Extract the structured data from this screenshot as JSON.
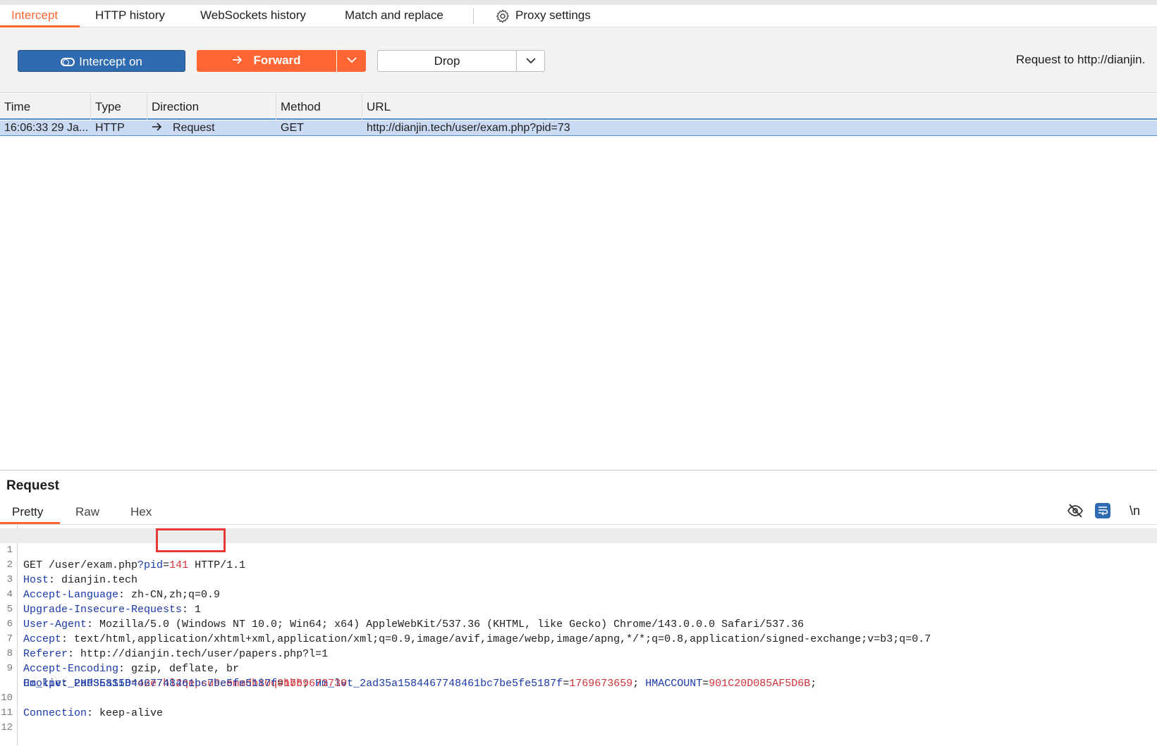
{
  "tabs": [
    {
      "label": "Intercept",
      "active": true
    },
    {
      "label": "HTTP history"
    },
    {
      "label": "WebSockets history"
    },
    {
      "label": "Match and replace"
    },
    {
      "label": "Proxy settings",
      "icon": "gear-icon"
    }
  ],
  "toolbar": {
    "intercept_label": "Intercept on",
    "forward_label": "Forward",
    "drop_label": "Drop",
    "request_to": "Request to http://dianjin."
  },
  "table": {
    "headers": [
      "Time",
      "Type",
      "Direction",
      "Method",
      "URL"
    ],
    "rows": [
      {
        "time": "16:06:33 29 Ja...",
        "type": "HTTP",
        "direction": "Request",
        "method": "GET",
        "url": "http://dianjin.tech/user/exam.php?pid=73"
      }
    ]
  },
  "request_panel": {
    "title": "Request",
    "subtabs": [
      "Pretty",
      "Raw",
      "Hex"
    ],
    "active_subtab": "Pretty",
    "newline_toggle": "\\n",
    "lines": {
      "l1": {
        "pre": "GET /user/exam.php",
        "param_key": "?pid",
        "eq": "=",
        "param_val": "141",
        "post": " HTTP/1.1"
      },
      "l2": {
        "name": "Host",
        "value": ": dianjin.tech"
      },
      "l3": {
        "name": "Accept-Language",
        "value": ": zh-CN,zh;q=0.9"
      },
      "l4": {
        "name": "Upgrade-Insecure-Requests",
        "value": ": 1"
      },
      "l5": {
        "name": "User-Agent",
        "value": ": Mozilla/5.0 (Windows NT 10.0; Win64; x64) AppleWebKit/537.36 (KHTML, like Gecko) Chrome/143.0.0.0 Safari/537.36"
      },
      "l6": {
        "name": "Accept",
        "value": ": text/html,application/xhtml+xml,application/xml;q=0.9,image/avif,image/webp,image/apng,*/*;q=0.8,application/signed-exchange;v=b3;q=0.7"
      },
      "l7": {
        "name": "Referer",
        "value": ": http://dianjin.tech/user/papers.php?l=1"
      },
      "l8": {
        "name": "Accept-Encoding",
        "value": ": gzip, deflate, br"
      },
      "l9": {
        "name": "Cookie",
        "sep": ": ",
        "c1k": "PHPSESSID",
        "c1v": "o2e7hl2qepsu9eemmdbi0q9hbb",
        "c2k": "Hm_lvt_2ad35a15844677484​61bc7be5fe5187f",
        "c2v": "1769673659",
        "c3k": "HMACCOUNT",
        "c3v": "901C20D085AF5D6B"
      },
      "l9b": {
        "c4k": "Hm_lpvt_2ad35a1584467748461bc7be5fe5187f",
        "c4v": "1769673730"
      },
      "l10": {
        "name": "Connection",
        "value": ": keep-alive"
      }
    },
    "line_numbers": [
      "1",
      "2",
      "3",
      "4",
      "5",
      "6",
      "7",
      "8",
      "9",
      "10",
      "11",
      "12"
    ]
  },
  "colors": {
    "accent": "#ff6633",
    "intercept_blue": "#2f6bb0",
    "selected_row": "#c9daf2",
    "highlight_box": "#e53935"
  }
}
